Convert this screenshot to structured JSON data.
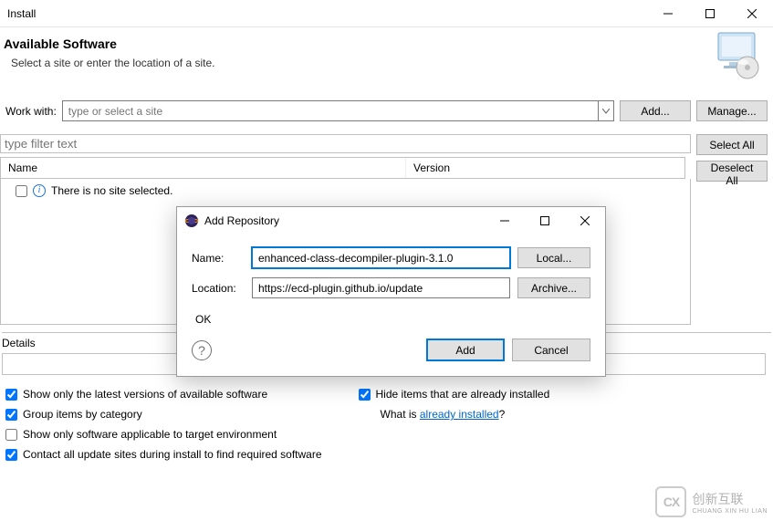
{
  "window": {
    "title": "Install"
  },
  "header": {
    "title": "Available Software",
    "subtitle": "Select a site or enter the location of a site."
  },
  "workwith": {
    "label": "Work with:",
    "placeholder": "type or select a site",
    "add": "Add...",
    "manage": "Manage..."
  },
  "filter": {
    "placeholder": "type filter text"
  },
  "sidebuttons": {
    "select_all": "Select All",
    "deselect_all": "Deselect All"
  },
  "columns": {
    "name": "Name",
    "version": "Version"
  },
  "empty_msg": "There is no site selected.",
  "details_label": "Details",
  "options": {
    "latest": "Show only the latest versions of available software",
    "group": "Group items by category",
    "target": "Show only software applicable to target environment",
    "contact": "Contact all update sites during install to find required software",
    "hide": "Hide items that are already installed",
    "what_prefix": "What is ",
    "what_link": "already installed",
    "what_suffix": "?"
  },
  "checked": {
    "latest": true,
    "group": true,
    "target": false,
    "contact": true,
    "hide": true
  },
  "dialog": {
    "title": "Add Repository",
    "name_label": "Name:",
    "name_value": "enhanced-class-decompiler-plugin-3.1.0",
    "loc_label": "Location:",
    "loc_value": "https://ecd-plugin.github.io/update",
    "local_btn": "Local...",
    "archive_btn": "Archive...",
    "ok": "OK",
    "add": "Add",
    "cancel": "Cancel"
  },
  "watermark": {
    "brand": "创新互联",
    "sub": "CHUANG XIN HU LIAN"
  }
}
